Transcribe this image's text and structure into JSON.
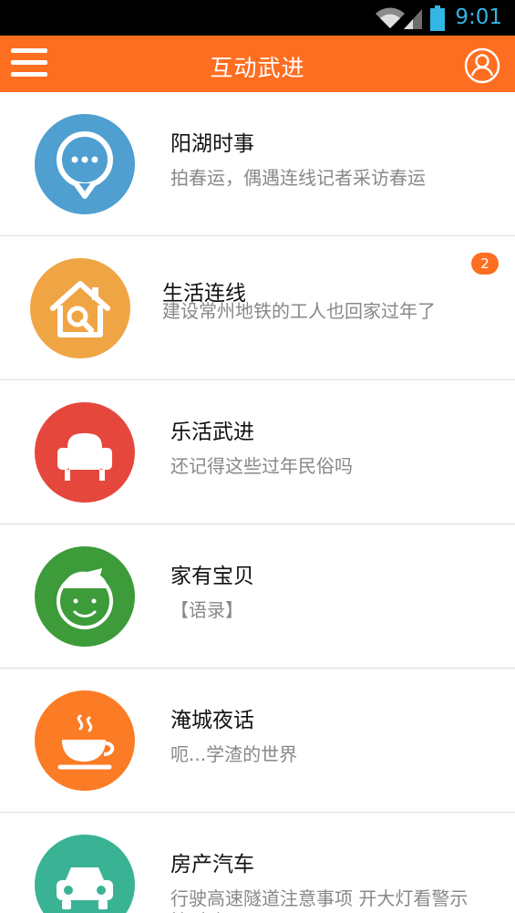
{
  "status_bar": {
    "time": "9:01"
  },
  "header": {
    "title": "互动武进"
  },
  "items": [
    {
      "title": "阳湖时事",
      "subtitle": "拍春运，偶遇连线记者采访春运",
      "color": "#4f9fd0",
      "icon": "chat-bubble-icon"
    },
    {
      "title": "生活连线",
      "subtitle": "建设常州地铁的工人也回家过年了",
      "color": "#f0a545",
      "icon": "house-search-icon",
      "badge": "2"
    },
    {
      "title": "乐活武进",
      "subtitle": "还记得这些过年民俗吗",
      "color": "#e5473d",
      "icon": "armchair-icon"
    },
    {
      "title": "家有宝贝",
      "subtitle": "【语录】",
      "color": "#3d9b3a",
      "icon": "baby-face-icon"
    },
    {
      "title": "淹城夜话",
      "subtitle": "呃...学渣的世界",
      "color": "#fc7b25",
      "icon": "coffee-cup-icon"
    },
    {
      "title": "房产汽车",
      "subtitle": "行驶高速隧道注意事项 开大灯看警示控时速",
      "color": "#3ab394",
      "icon": "car-icon"
    }
  ]
}
